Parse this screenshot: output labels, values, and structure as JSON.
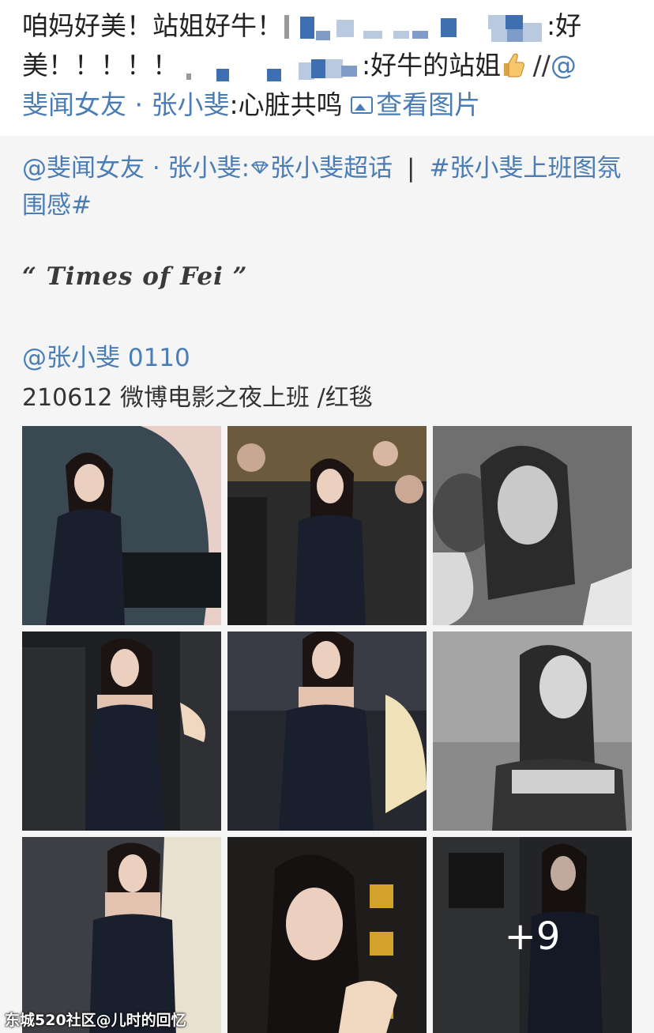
{
  "repost": {
    "line1_a": "咱妈好美！站姐好牛！",
    "line1_b": ":好",
    "line2_a": "美！！！！！",
    "line2_b": ":好牛的站姐",
    "line2_c": " //",
    "mention_at": "@",
    "mention_name": "斐闻女友 · 张小斐",
    "line3_b": ":心脏共鸣 ",
    "view_pictures": "查看图片"
  },
  "original": {
    "author": "@斐闻女友 · 张小斐",
    "colon": ":",
    "supertopic": "张小斐超话",
    "separator": "|",
    "hashtag": "#张小斐上班图氛围感#",
    "quote": "“ Times of Fei ”",
    "user": "@张小斐 0110",
    "event": "210612 微博电影之夜上班 /红毯"
  },
  "grid": {
    "more_count": "+9"
  },
  "watermark": "东城520社区@儿时的回忆",
  "colors": {
    "link": "#4a7db5",
    "text": "#222222",
    "card_bg": "#f5f5f6"
  },
  "icons": [
    "thumbs-up-icon",
    "picture-icon",
    "diamond-icon"
  ]
}
